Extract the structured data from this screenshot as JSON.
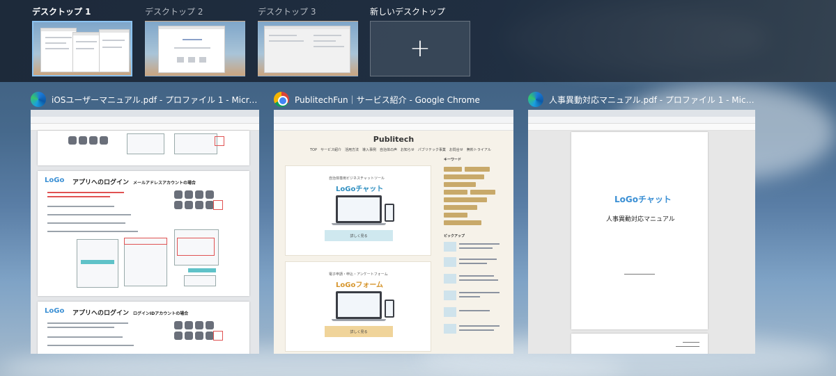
{
  "desktops": [
    {
      "label": "デスクトップ 1",
      "active": true
    },
    {
      "label": "デスクトップ 2",
      "active": false
    },
    {
      "label": "デスクトップ 3",
      "active": false
    }
  ],
  "new_desktop": {
    "label": "新しいデスクトップ",
    "icon": "plus-icon"
  },
  "windows": [
    {
      "title": "iOSユーザーマニュアル.pdf - プロファイル 1 - Microsoft...",
      "app_icon": "edge-icon",
      "content": {
        "heading_1": "アプリへのログイン",
        "heading_1_sub": "メールアドレスアカウントの場合",
        "heading_2": "アプリへのログイン",
        "heading_2_sub": "ログインIDアカウントの場合",
        "logo": "LoGo"
      }
    },
    {
      "title": "PublitechFun｜サービス紹介 - Google Chrome",
      "app_icon": "chrome-icon",
      "content": {
        "site_logo": "Publitech",
        "nav": "TOP　サービス紹介　活用方法　導入事例　自治体の声　お知らせ　パブリテック事業　お問合せ　無料トライアル",
        "sidebar_keyword": "キーワード",
        "sidebar_pickup": "ピックアップ",
        "card_1_sub": "自治体専用ビジネスチャットツール",
        "card_1_title": "LoGoチャット",
        "card_1_button": "詳しく見る",
        "card_2_sub": "電子申請・申込・アンケートフォーム",
        "card_2_title": "LoGoフォーム",
        "card_2_button": "詳しく見る"
      }
    },
    {
      "title": "人事異動対応マニュアル.pdf - プロファイル 1 - Micros...",
      "app_icon": "edge-icon",
      "content": {
        "logo": "LoGoチャット",
        "doc_title": "人事異動対応マニュアル"
      }
    }
  ],
  "colors": {
    "accent_border": "#8cc4f2",
    "logo_blue": "#3a8fd4",
    "teal": "#5fc2c8",
    "orange": "#f0d49a"
  }
}
